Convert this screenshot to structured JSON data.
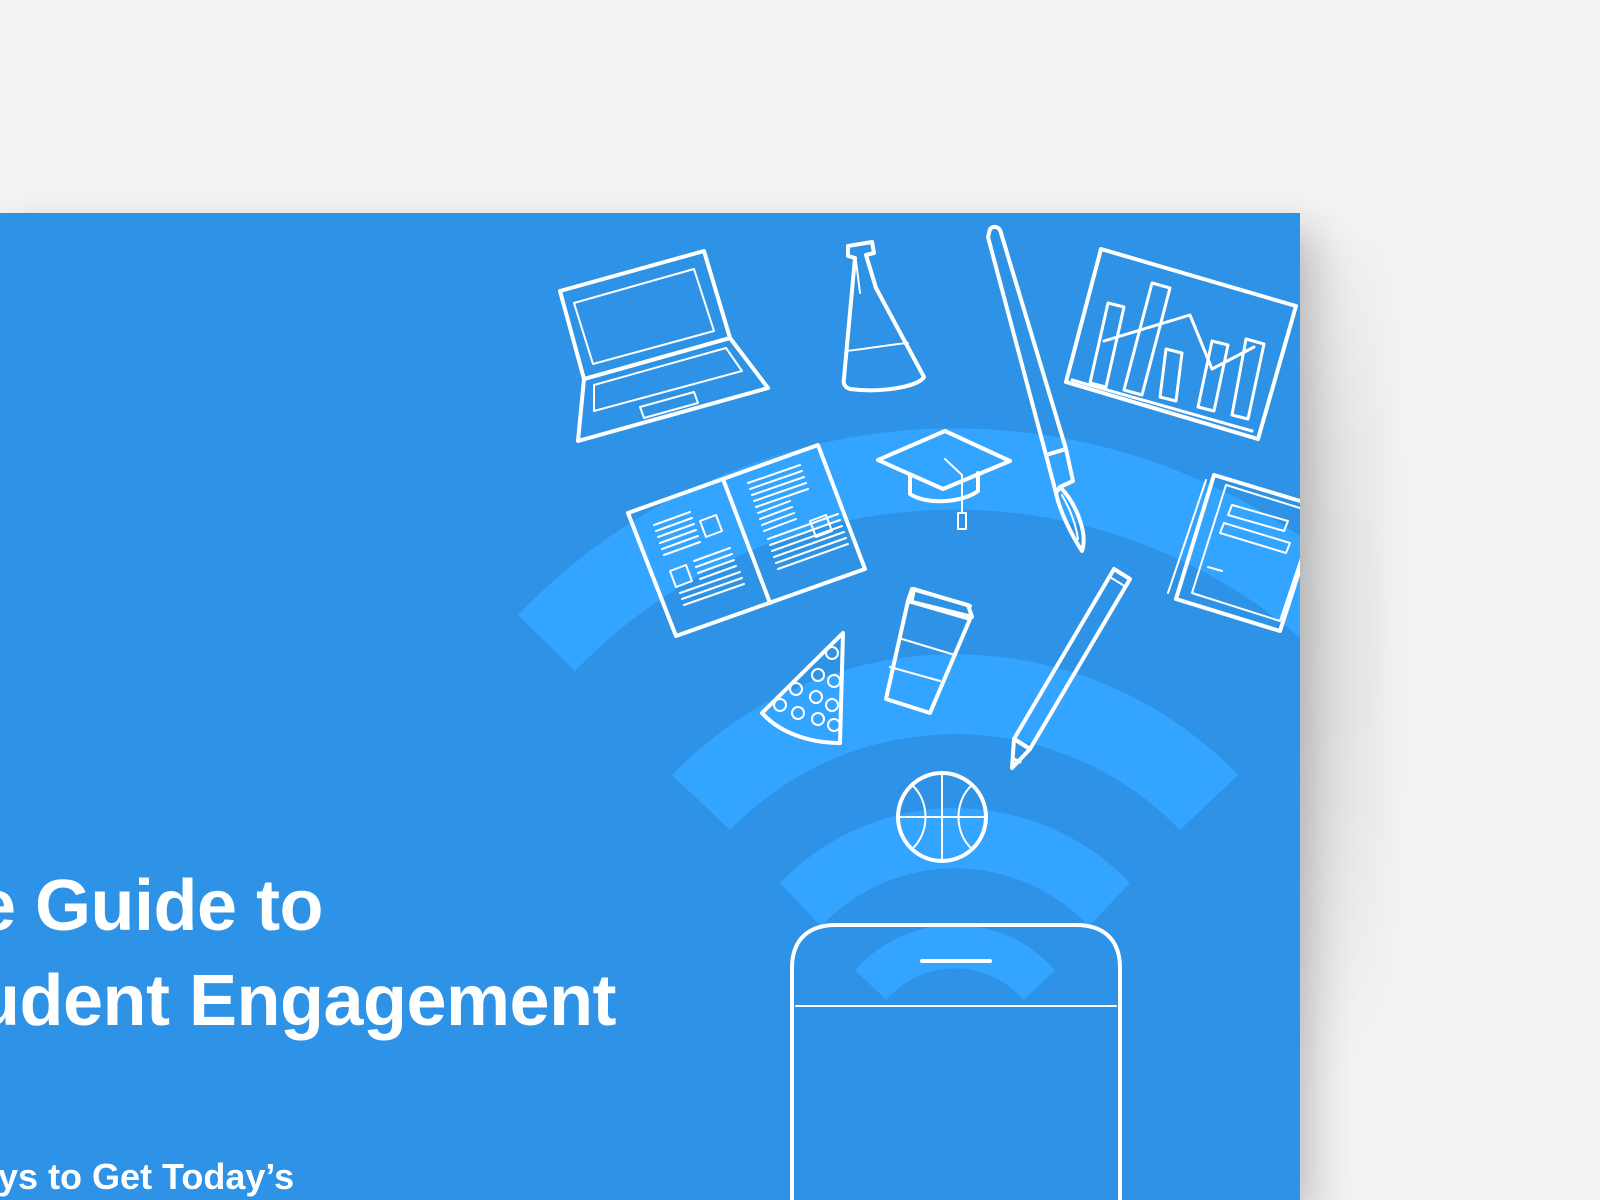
{
  "cover": {
    "title_line_1": "e Guide to",
    "title_line_2": "udent Engagement",
    "subtitle": "ays to Get Today’s",
    "background_color": "#2e93e6",
    "wave_color": "#33a4ff",
    "line_color": "#ffffff"
  },
  "icons": [
    "laptop-icon",
    "flask-icon",
    "paintbrush-icon",
    "bar-chart-icon",
    "open-book-icon",
    "graduation-cap-icon",
    "notebook-icon",
    "coffee-cup-icon",
    "pizza-slice-icon",
    "pencil-icon",
    "basketball-icon",
    "smartphone-icon"
  ]
}
